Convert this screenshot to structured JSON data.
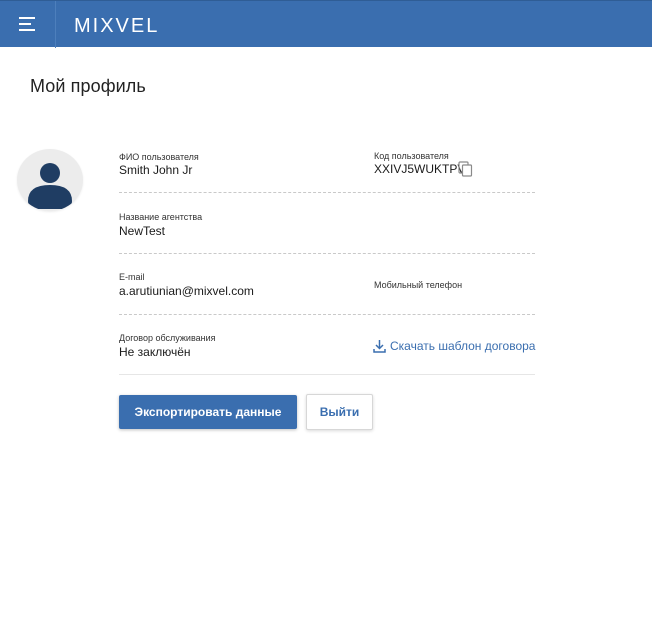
{
  "header": {
    "logo_text": "MIXVEL",
    "brand_color": "#3a6eaf",
    "menu_icon": "hamburger-menu-icon"
  },
  "page": {
    "title": "Мой профиль"
  },
  "profile": {
    "avatar_icon": "user-avatar-icon",
    "full_name": {
      "label": "ФИО пользователя",
      "value": "Smith John Jr"
    },
    "user_code": {
      "label": "Код пользователя",
      "value": "XXIVJ5WUKTPV",
      "copy_icon": "copy-icon"
    },
    "agency": {
      "label": "Название агентства",
      "value": "NewTest"
    },
    "email": {
      "label": "E-mail",
      "value": "a.arutiunian@mixvel.com"
    },
    "mobile": {
      "label": "Мобильный телефон",
      "value": ""
    },
    "contract": {
      "label": "Договор обслуживания",
      "value": "Не заключён"
    },
    "download_template": {
      "label": "Скачать шаблон договора",
      "icon": "download-icon"
    }
  },
  "actions": {
    "export_label": "Экспортировать данные",
    "logout_label": "Выйти"
  }
}
